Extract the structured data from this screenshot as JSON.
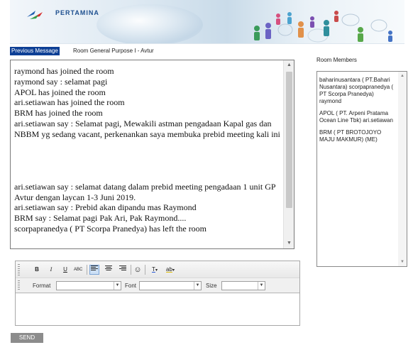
{
  "banner": {
    "brand": "PERTAMINA"
  },
  "tabs": {
    "previous_message": "Previous Message",
    "room_title": "Room General Purpose I - Avtur"
  },
  "chat": {
    "messages": [
      "raymond has joined the room",
      "raymond say : selamat pagi",
      "APOL has joined the room",
      "ari.setiawan has joined the room",
      "BRM has joined the room",
      "ari.setiawan say : Selamat pagi, Mewakili astman pengadaan Kapal gas dan NBBM yg sedang vacant, perkenankan saya membuka prebid meeting kali ini",
      "",
      "",
      "",
      "",
      "ari.setiawan say : selamat datang dalam prebid meeting pengadaan 1 unit GP Avtur dengan laycan 1-3 Juni 2019.",
      "ari.setiawan say : Prebid akan dipandu mas Raymond",
      "BRM say : Selamat pagi Pak Ari, Pak Raymond....",
      "scorpapranedya ( PT Scorpa Pranedya) has left the room"
    ]
  },
  "members": {
    "title": "Room Members",
    "list": [
      "baharinusantara ( PT.Bahari Nusantara) scorpapranedya ( PT Scorpa Pranedya) raymond",
      "APOL ( PT. Arpeni Pratama Ocean Line Tbk) ari.setiawan",
      "BRM ( PT BROTOJOYO MAJU MAKMUR) (ME)"
    ]
  },
  "editor": {
    "toolbar": {
      "bold": "B",
      "italic": "I",
      "underline": "U",
      "strike": "ABC",
      "emoji": "☺",
      "text_color": "T",
      "highlight": "ab"
    },
    "format_label": "Format",
    "font_label": "Font",
    "size_label": "Size",
    "format_value": "",
    "font_value": "",
    "size_value": ""
  },
  "send_label": "SEND",
  "colors": {
    "tab_active": "#0d3f95",
    "send_bg": "#8c8c8c",
    "selected_tool": "#cde0f5"
  }
}
